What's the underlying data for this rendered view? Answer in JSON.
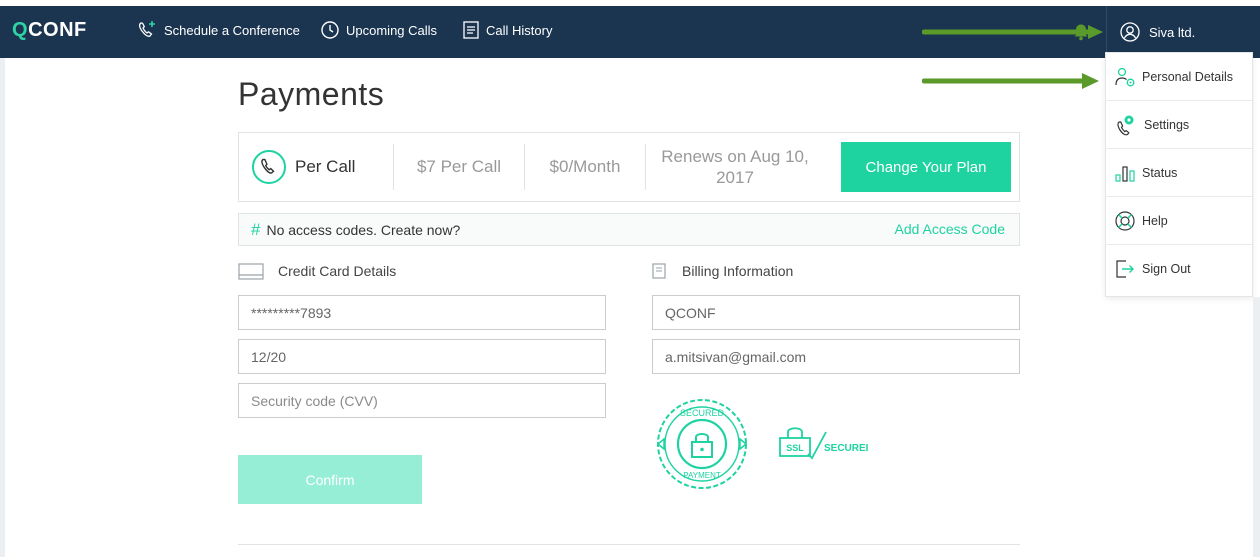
{
  "app": {
    "logo_q": "Q",
    "logo_rest": "CONF"
  },
  "nav": {
    "schedule": "Schedule a Conference",
    "upcoming": "Upcoming Calls",
    "history": "Call History",
    "user": "Siva ltd."
  },
  "page": {
    "title": "Payments"
  },
  "plan": {
    "name": "Per Call",
    "price": "$7 Per Call",
    "monthly": "$0/Month",
    "renews_line1": "Renews on Aug 10,",
    "renews_line2": "2017",
    "change_button": "Change Your Plan"
  },
  "access": {
    "message": "No access codes. Create now?",
    "add_link": "Add Access Code"
  },
  "credit_card": {
    "heading": "Credit Card Details",
    "number": "*********7893",
    "expiry": "12/20",
    "cvv_placeholder": "Security code (CVV)"
  },
  "billing": {
    "heading": "Billing Information",
    "company": "QCONF",
    "email": "a.mitsivan@gmail.com"
  },
  "badges": {
    "secured_top": "SECURED",
    "secured_bottom": "PAYMENT",
    "ssl": "SSL",
    "ssl_secured": "SECUREI"
  },
  "confirm_button": "Confirm",
  "menu": {
    "personal": "Personal Details",
    "settings": "Settings",
    "status": "Status",
    "help": "Help",
    "signout": "Sign Out"
  },
  "colors": {
    "navbar": "#1b3550",
    "accent": "#1ed3a0",
    "arrow": "#5a9a2a"
  }
}
